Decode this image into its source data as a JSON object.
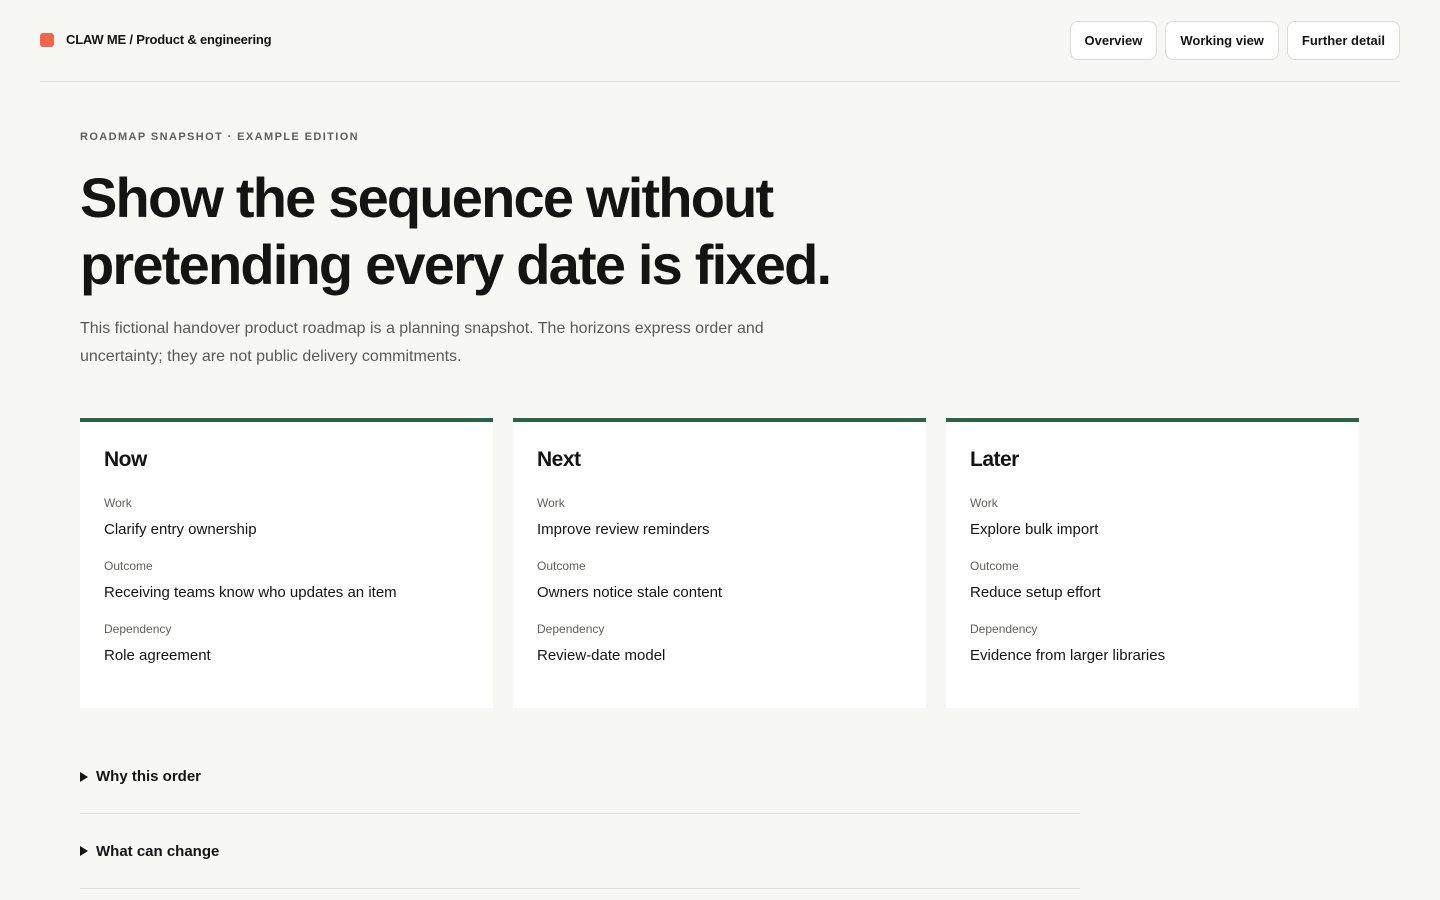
{
  "header": {
    "brand": "CLAW ME / Product & engineering",
    "brand_color": "#ef654d",
    "nav": [
      "Overview",
      "Working view",
      "Further detail"
    ]
  },
  "hero": {
    "eyebrow": "ROADMAP SNAPSHOT · EXAMPLE EDITION",
    "headline": "Show the sequence without pretending every date is fixed.",
    "intro": "This fictional handover product roadmap is a planning snapshot. The horizons express order and uncertainty; they are not public delivery commitments."
  },
  "accent_color": "#2c6247",
  "horizons": [
    {
      "title": "Now",
      "fields": [
        {
          "label": "Work",
          "value": "Clarify entry ownership"
        },
        {
          "label": "Outcome",
          "value": "Receiving teams know who updates an item"
        },
        {
          "label": "Dependency",
          "value": "Role agreement"
        }
      ]
    },
    {
      "title": "Next",
      "fields": [
        {
          "label": "Work",
          "value": "Improve review reminders"
        },
        {
          "label": "Outcome",
          "value": "Owners notice stale content"
        },
        {
          "label": "Dependency",
          "value": "Review-date model"
        }
      ]
    },
    {
      "title": "Later",
      "fields": [
        {
          "label": "Work",
          "value": "Explore bulk import"
        },
        {
          "label": "Outcome",
          "value": "Reduce setup effort"
        },
        {
          "label": "Dependency",
          "value": "Evidence from larger libraries"
        }
      ]
    }
  ],
  "disclosures": [
    {
      "label": "Why this order",
      "icon": "triangle-right-icon"
    },
    {
      "label": "What can change",
      "icon": "triangle-right-icon"
    }
  ]
}
